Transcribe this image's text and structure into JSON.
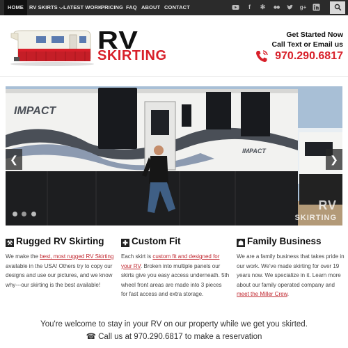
{
  "nav": {
    "items": [
      "HOME",
      "RV SKIRTS ⌵",
      "LATEST WORK",
      "PRICING",
      "FAQ",
      "ABOUT",
      "CONTACT"
    ],
    "social_icons": [
      "youtube-icon",
      "facebook-icon",
      "yelp-icon",
      "flickr-icon",
      "twitter-icon",
      "google-plus-icon",
      "linkedin-icon"
    ]
  },
  "header": {
    "brand_rv": "RV",
    "brand_skirting": "SKIRTING",
    "cta_line1": "Get Started Now",
    "cta_line2": "Call Text or Email us",
    "phone": "970.290.6817"
  },
  "slider": {
    "prev": "❮",
    "next": "❯",
    "watermark_rv": "RV",
    "watermark_skirting": "SKIRTING",
    "rv_brand_text": "IMPACT"
  },
  "features": [
    {
      "title": "Rugged RV Skirting",
      "icon": "wrench-icon",
      "text_before": "We make the ",
      "link": "best, most rugged RV Skirting",
      "text_after": " available in the USA! Others try to copy our designs and use our pictures, and we know why---our skirting is the best available!"
    },
    {
      "title": "Custom Fit",
      "icon": "puzzle-icon",
      "text_before": "Each skirt is ",
      "link": "custom fit and designed for your RV",
      "text_after": ". Broken into multiple panels our skirts give you easy access underneath. 5th wheel front areas are made into 3 pieces for fast access and extra storage."
    },
    {
      "title": "Family Business",
      "icon": "family-icon",
      "text_before": "We are a family business that takes pride in our work. We've made skirting for over 19 years now. We specialize in it. Learn more about our family operated company and ",
      "link": "meet the Miller Crew",
      "text_after": "."
    }
  ],
  "bottom": {
    "line1": "You're welcome to stay in your RV on our property while we get you skirted.",
    "line2": "☎ Call us at 970.290.6817 to make a reservation"
  },
  "colors": {
    "nav_bg": "#2b2b2b",
    "accent_red": "#d8202a",
    "link_red": "#c0262e"
  }
}
